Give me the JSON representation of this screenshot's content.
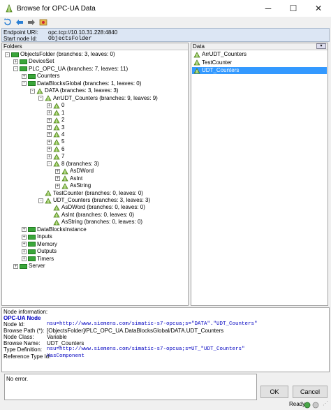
{
  "window": {
    "title": "Browse for OPC-UA Data"
  },
  "toolbar": {
    "icons": [
      "refresh-icon",
      "back-icon",
      "forward-icon",
      "home-icon"
    ]
  },
  "endpoint": {
    "uri_label": "Endpoint URI:",
    "uri_value": "opc.tcp://10.10.31.228:4840",
    "start_label": "Start node Id:",
    "start_value": "ObjectsFolder"
  },
  "folders": {
    "header": "Folders",
    "tree": [
      {
        "label": "ObjectsFolder (branches: 3, leaves: 0)",
        "depth": 0,
        "exp": "-",
        "icon": "folder"
      },
      {
        "label": "DeviceSet",
        "depth": 1,
        "exp": "+",
        "icon": "folder"
      },
      {
        "label": "PLC_OPC_UA (branches: 7, leaves: 11)",
        "depth": 1,
        "exp": "-",
        "icon": "folder"
      },
      {
        "label": "Counters",
        "depth": 2,
        "exp": "+",
        "icon": "folder"
      },
      {
        "label": "DataBlocksGlobal (branches: 1, leaves: 0)",
        "depth": 2,
        "exp": "-",
        "icon": "folder"
      },
      {
        "label": "DATA (branches: 3, leaves: 3)",
        "depth": 3,
        "exp": "-",
        "icon": "node"
      },
      {
        "label": "ArrUDT_Counters (branches: 9, leaves: 9)",
        "depth": 4,
        "exp": "-",
        "icon": "node"
      },
      {
        "label": "0",
        "depth": 5,
        "exp": "+",
        "icon": "node"
      },
      {
        "label": "1",
        "depth": 5,
        "exp": "+",
        "icon": "node"
      },
      {
        "label": "2",
        "depth": 5,
        "exp": "+",
        "icon": "node"
      },
      {
        "label": "3",
        "depth": 5,
        "exp": "+",
        "icon": "node"
      },
      {
        "label": "4",
        "depth": 5,
        "exp": "+",
        "icon": "node"
      },
      {
        "label": "5",
        "depth": 5,
        "exp": "+",
        "icon": "node"
      },
      {
        "label": "6",
        "depth": 5,
        "exp": "+",
        "icon": "node"
      },
      {
        "label": "7",
        "depth": 5,
        "exp": "+",
        "icon": "node"
      },
      {
        "label": "8 (branches: 3)",
        "depth": 5,
        "exp": "-",
        "icon": "node"
      },
      {
        "label": "AsDWord",
        "depth": 6,
        "exp": "+",
        "icon": "node"
      },
      {
        "label": "AsInt",
        "depth": 6,
        "exp": "+",
        "icon": "node"
      },
      {
        "label": "AsString",
        "depth": 6,
        "exp": "+",
        "icon": "node"
      },
      {
        "label": "TestCounter (branches: 0, leaves: 0)",
        "depth": 4,
        "exp": "",
        "icon": "node"
      },
      {
        "label": "UDT_Counters (branches: 3, leaves: 3)",
        "depth": 4,
        "exp": "-",
        "icon": "node"
      },
      {
        "label": "AsDWord (branches: 0, leaves: 0)",
        "depth": 5,
        "exp": "",
        "icon": "node"
      },
      {
        "label": "AsInt (branches: 0, leaves: 0)",
        "depth": 5,
        "exp": "",
        "icon": "node"
      },
      {
        "label": "AsString (branches: 0, leaves: 0)",
        "depth": 5,
        "exp": "",
        "icon": "node"
      },
      {
        "label": "DataBlocksInstance",
        "depth": 2,
        "exp": "+",
        "icon": "folder"
      },
      {
        "label": "Inputs",
        "depth": 2,
        "exp": "+",
        "icon": "folder"
      },
      {
        "label": "Memory",
        "depth": 2,
        "exp": "+",
        "icon": "folder"
      },
      {
        "label": "Outputs",
        "depth": 2,
        "exp": "+",
        "icon": "folder"
      },
      {
        "label": "Timers",
        "depth": 2,
        "exp": "+",
        "icon": "folder"
      },
      {
        "label": "Server",
        "depth": 1,
        "exp": "+",
        "icon": "folder"
      }
    ]
  },
  "data_panel": {
    "header": "Data",
    "items": [
      {
        "label": "ArrUDT_Counters",
        "selected": false
      },
      {
        "label": "TestCounter",
        "selected": false
      },
      {
        "label": "UDT_Counters",
        "selected": true
      }
    ]
  },
  "info": {
    "heading": "Node information:",
    "node_type": "OPC-UA Node",
    "fields": [
      {
        "label": "Node Id:",
        "value": "nsu=http://www.siemens.com/simatic-s7-opcua;s=\"DATA\".\"UDT_Counters\"",
        "mono": true
      },
      {
        "label": "Browse Path (*):",
        "value": "[ObjectsFolder]/PLC_OPC_UA.DataBlocksGlobal/DATA.UDT_Counters",
        "mono": false
      },
      {
        "label": "Node Class:",
        "value": "Variable",
        "mono": false
      },
      {
        "label": "Browse Name:",
        "value": "UDT_Counters",
        "mono": false
      },
      {
        "label": "Type Definition:",
        "value": "nsu=http://www.siemens.com/simatic-s7-opcua;s=UT_\"UDT_Counters\"",
        "mono": true
      },
      {
        "label": "Reference Type Id:",
        "value": "HasComponent",
        "mono": true
      }
    ]
  },
  "status": {
    "message": "No error.",
    "ready": "Ready"
  },
  "buttons": {
    "ok": "OK",
    "cancel": "Cancel"
  },
  "colors": {
    "accent": "#3399ff",
    "node_green": "#3aa63a",
    "endpoint_bg": "#dce6f4",
    "info_blue": "#0000c0"
  }
}
